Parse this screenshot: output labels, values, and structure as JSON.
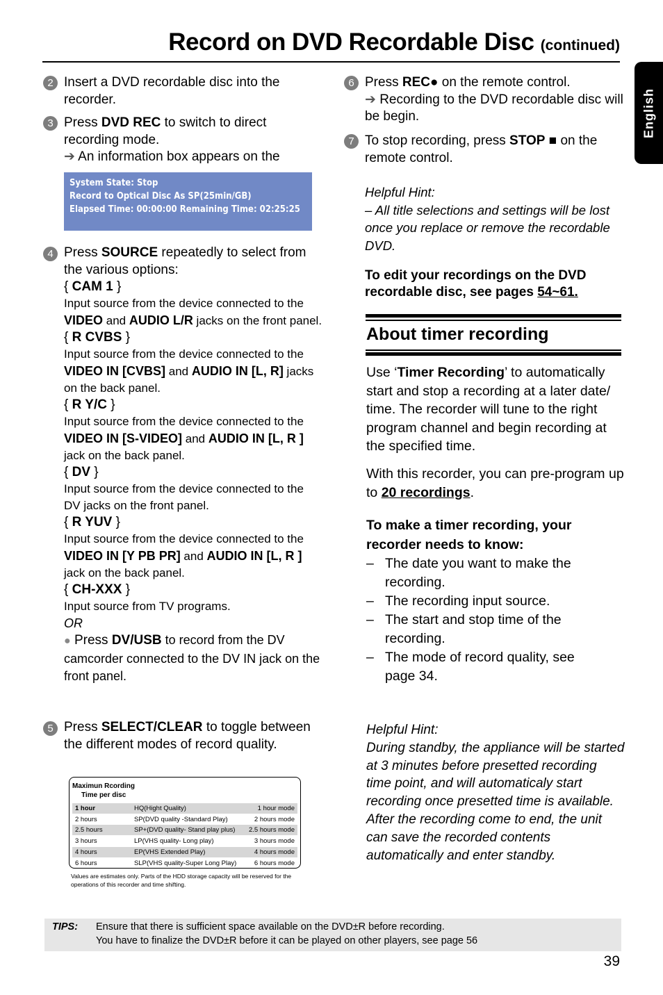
{
  "header": {
    "title": "Record on DVD Recordable Disc",
    "continued": "(continued)",
    "language_tab": "English"
  },
  "left_column": {
    "step2": {
      "number": "2",
      "text": "Insert a DVD recordable disc into the recorder."
    },
    "step3": {
      "number": "3",
      "press": "Press ",
      "key": "DVD REC",
      "rest": " to switch to direct recording mode.",
      "result_arrow": "➔",
      "result": "An information box appears on the"
    },
    "info_box": {
      "line1": "System State: Stop",
      "line2": "Record to Optical Disc As SP(25min/GB)",
      "line3": "Elapsed Time:  00:00:00 Remaining Time: 02:25:25",
      "background": "#7189c6"
    },
    "step4": {
      "number": "4",
      "press": "Press ",
      "key": "SOURCE",
      "rest": " repeatedly to select from the various options:",
      "options": [
        {
          "name": "CAM 1",
          "desc": [
            {
              "t": "Input source from the device connected to the ",
              "b": false
            },
            {
              "t": "VIDEO",
              "b": true
            },
            {
              "t": " and ",
              "b": false
            },
            {
              "t": "AUDIO L/R",
              "b": true
            },
            {
              "t": " jacks on the front panel.",
              "b": false
            }
          ]
        },
        {
          "name": "R CVBS",
          "desc": [
            {
              "t": "Input source from the device connected to the ",
              "b": false
            },
            {
              "t": "VIDEO IN [CVBS]",
              "b": true
            },
            {
              "t": " and ",
              "b": false
            },
            {
              "t": "AUDIO IN [L, R]",
              "b": true
            },
            {
              "t": " jacks on the back panel.",
              "b": false
            }
          ]
        },
        {
          "name": "R Y/C",
          "desc": [
            {
              "t": "Input source from the device connected to the ",
              "b": false
            },
            {
              "t": "VIDEO IN [S-VIDEO]",
              "b": true
            },
            {
              "t": " and ",
              "b": false
            },
            {
              "t": "AUDIO IN [L, R ]",
              "b": true
            },
            {
              "t": " jack on the back panel.",
              "b": false
            }
          ]
        },
        {
          "name": "DV",
          "desc": [
            {
              "t": "Input source from the device connected to the DV jacks on the front panel.",
              "b": false
            }
          ]
        },
        {
          "name": "R YUV",
          "desc": [
            {
              "t": "Input source from the device connected to the ",
              "b": false
            },
            {
              "t": "VIDEO IN [Y PB PR]",
              "b": true
            },
            {
              "t": " and ",
              "b": false
            },
            {
              "t": "AUDIO IN [L, R ]",
              "b": true
            },
            {
              "t": " jack on the back panel.",
              "b": false
            }
          ]
        },
        {
          "name": "CH-XXX",
          "desc": [
            {
              "t": "Input source from TV programs.",
              "b": false
            }
          ]
        }
      ],
      "or": "OR",
      "bullet_press": "Press ",
      "bullet_key": "DV/USB",
      "bullet_rest": " to record from the DV camcorder connected to the DV IN jack on the front panel."
    },
    "step5": {
      "number": "5",
      "press": "Press ",
      "key": "SELECT/CLEAR",
      "rest": " to toggle between the different modes of record quality."
    },
    "quality_table": {
      "heading_line1": "Maximun Rcording",
      "heading_line2": "Time per disc",
      "rows": [
        {
          "time": "1 hour",
          "mode": "HQ(Hight Quality)",
          "label": "1 hour mode",
          "bold": true,
          "shaded": true
        },
        {
          "time": "2 hours",
          "mode": "SP(DVD quality -Standard Play)",
          "label": "2 hours mode",
          "bold": false,
          "shaded": false
        },
        {
          "time": "2.5 hours",
          "mode": "SP+(DVD quality- Stand play plus)",
          "label": "2.5 hours mode",
          "bold": false,
          "shaded": true
        },
        {
          "time": "3 hours",
          "mode": "LP(VHS quality- Long play)",
          "label": "3 hours mode",
          "bold": false,
          "shaded": false
        },
        {
          "time": "4 hours",
          "mode": "EP(VHS Extended Play)",
          "label": "4 hours mode",
          "bold": false,
          "shaded": true
        },
        {
          "time": "6 hours",
          "mode": "SLP(VHS quality-Super Long Play)",
          "label": "6 hours mode",
          "bold": false,
          "shaded": false
        }
      ],
      "note": "Values are estimates only. Parts of the HDD storage capacity will be reserved for the operations of this recorder and time shifting."
    }
  },
  "right_column": {
    "step6": {
      "number": "6",
      "press": "Press ",
      "key": "REC",
      "key_symbol": "●",
      "rest": " on the remote control.",
      "result_arrow": "➔",
      "result": "Recording to the DVD recordable disc will be begin."
    },
    "step7": {
      "number": "7",
      "pre": "To stop recording, press ",
      "key": "STOP",
      "key_symbol": "■",
      "rest": "  on the remote control."
    },
    "hint1": {
      "title": "Helpful Hint:",
      "text": "– All title selections and settings will be lost once you replace or remove the recordable DVD."
    },
    "edit_note": {
      "text": "To edit your recordings on the DVD recordable disc, see pages ",
      "pages": "54~61."
    },
    "section": {
      "title": "About timer recording",
      "intro_pre": "Use ‘",
      "intro_key": "Timer Recording",
      "intro_rest": "’ to automatically start and stop a recording at a later date/ time. The recorder will tune to the right program channel and begin recording at the specified time.",
      "preprog_pre": "With this recorder, you can pre-program up to ",
      "preprog_key": "20 recordings",
      "preprog_post": ".",
      "needs_heading": "To make a timer recording, your recorder needs to know:",
      "needs": [
        "The date you want to make the recording.",
        "The recording input source.",
        "The start and stop time of the recording.",
        "The mode of record quality, see page 34."
      ],
      "dash": "–"
    },
    "hint2": {
      "title": "Helpful Hint:",
      "text": "During standby, the appliance will be started at 3 minutes before presetted recording time point, and will automaticaly start recording once presetted time is available. After the recording come to end, the unit can save the recorded contents automatically and enter standby."
    }
  },
  "tips": {
    "label": "TIPS:",
    "line1": "Ensure that there is sufficient space available on the DVD±R before recording.",
    "line2": "You have to finalize the DVD±R before it can be played on other players, see page 56"
  },
  "page_number": "39"
}
